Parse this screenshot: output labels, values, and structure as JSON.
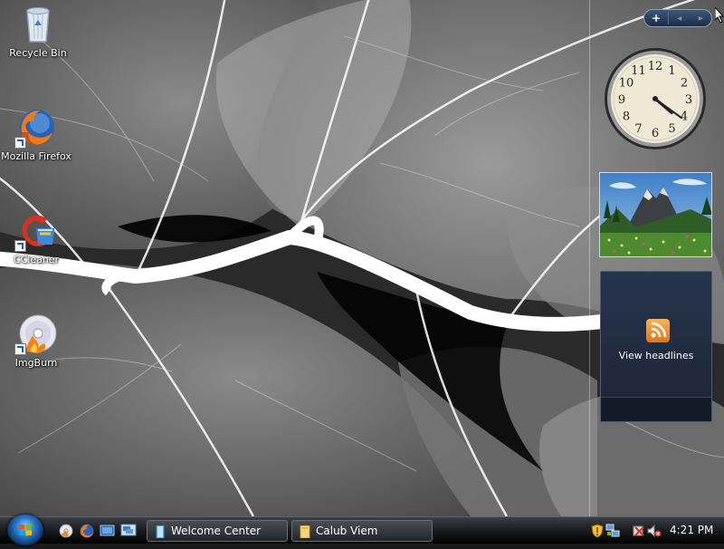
{
  "desktop_icons": [
    {
      "label": "Recycle Bin"
    },
    {
      "label": "Mozilla Firefox"
    },
    {
      "label": "CCleaner"
    },
    {
      "label": "ImgBurn"
    }
  ],
  "sidebar": {
    "toolbar": {
      "add_label": "+",
      "prev_label": "◂",
      "next_label": "▸"
    },
    "clock": {
      "numbers": [
        "12",
        "1",
        "2",
        "3",
        "4",
        "5",
        "6",
        "7",
        "8",
        "9",
        "10",
        "11"
      ],
      "hour": 4,
      "minute": 21
    },
    "slideshow": {
      "subject": "mountain meadow photo"
    },
    "feed": {
      "label": "View headlines",
      "icon": "rss-icon"
    }
  },
  "taskbar": {
    "quick_launch": [
      "desktop-icon",
      "firefox-icon",
      "switch-windows-icon",
      "show-desktop-icon"
    ],
    "buttons": [
      {
        "label": "Welcome Center",
        "icon": "welcome-center-icon"
      },
      {
        "label": "Calub Viem",
        "icon": "folder-icon"
      }
    ],
    "tray_icons": [
      "security-shield-icon",
      "network-icon",
      "volume-muted-icon",
      "power-icon"
    ],
    "time": "4:21 PM"
  }
}
